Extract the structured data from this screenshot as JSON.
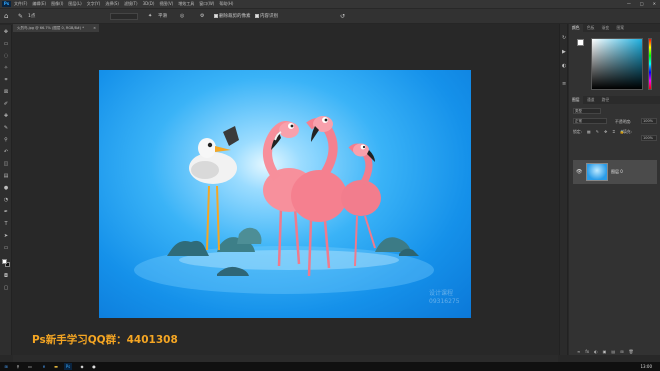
{
  "app": {
    "logo": "Ps"
  },
  "menu": {
    "items": [
      "文件(F)",
      "编辑(E)",
      "图像(I)",
      "图层(L)",
      "文字(Y)",
      "选择(S)",
      "滤镜(T)",
      "3D(D)",
      "视图(V)",
      "增效工具",
      "窗口(W)",
      "帮助(H)"
    ],
    "window_controls": [
      "—",
      "□",
      "✕"
    ]
  },
  "options_bar": {
    "home_icon": "home-icon",
    "size_value": "1点",
    "opacity_label": "不透明度",
    "smoothing_label": "平滑",
    "checkbox_label": "删除裁剪的像素",
    "checkbox_label_2": "内容识别"
  },
  "document": {
    "tab_label": "火烈鸟.jpg @ 66.7% (图层 0, RGB/8#) *",
    "close_label": "×"
  },
  "canvas": {
    "watermark_line1": "设计课程",
    "watermark_line2": "09316275",
    "banner": "Ps新手学习QQ群：4401308"
  },
  "panels": {
    "color_tabs": [
      "颜色",
      "色板",
      "渐变",
      "图案"
    ],
    "layer_tabs": [
      "图层",
      "通道",
      "路径"
    ],
    "search_label": "类型",
    "blend_mode": "正常",
    "opacity_label": "不透明度:",
    "opacity_value": "100%",
    "lock_label": "锁定:",
    "fill_label": "填充:",
    "fill_value": "100%",
    "layer_name": "图层 0",
    "footer_icons": [
      "∞",
      "fx",
      "◐",
      "▣",
      "▤",
      "⊞",
      "🗑"
    ]
  },
  "taskbar": {
    "start_icon": "windows-icon",
    "time": "13:00"
  },
  "colors": {
    "accent": "#31a8ff",
    "banner": "#f5a623",
    "canvas_bg": "#1591ea"
  }
}
